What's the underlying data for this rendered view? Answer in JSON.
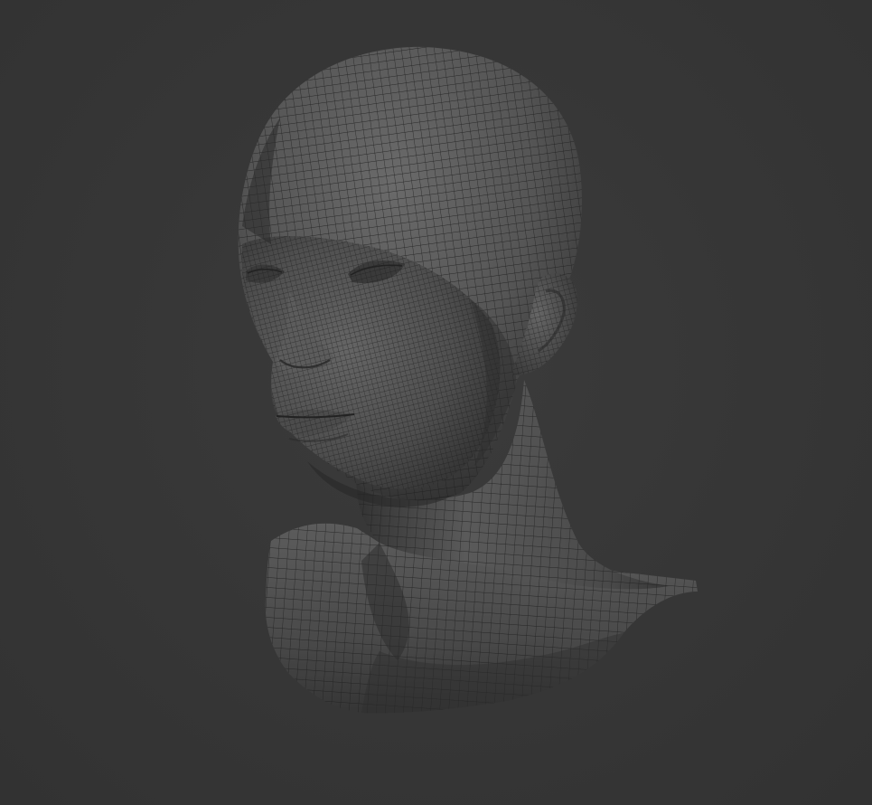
{
  "scene": {
    "subject": "head-bust-wireframe-mesh",
    "colors": {
      "background": "#363636",
      "mesh_base": "#5a5a5a",
      "mesh_shadow": "#2c2c2c",
      "wire": "#1e1e1e"
    }
  }
}
